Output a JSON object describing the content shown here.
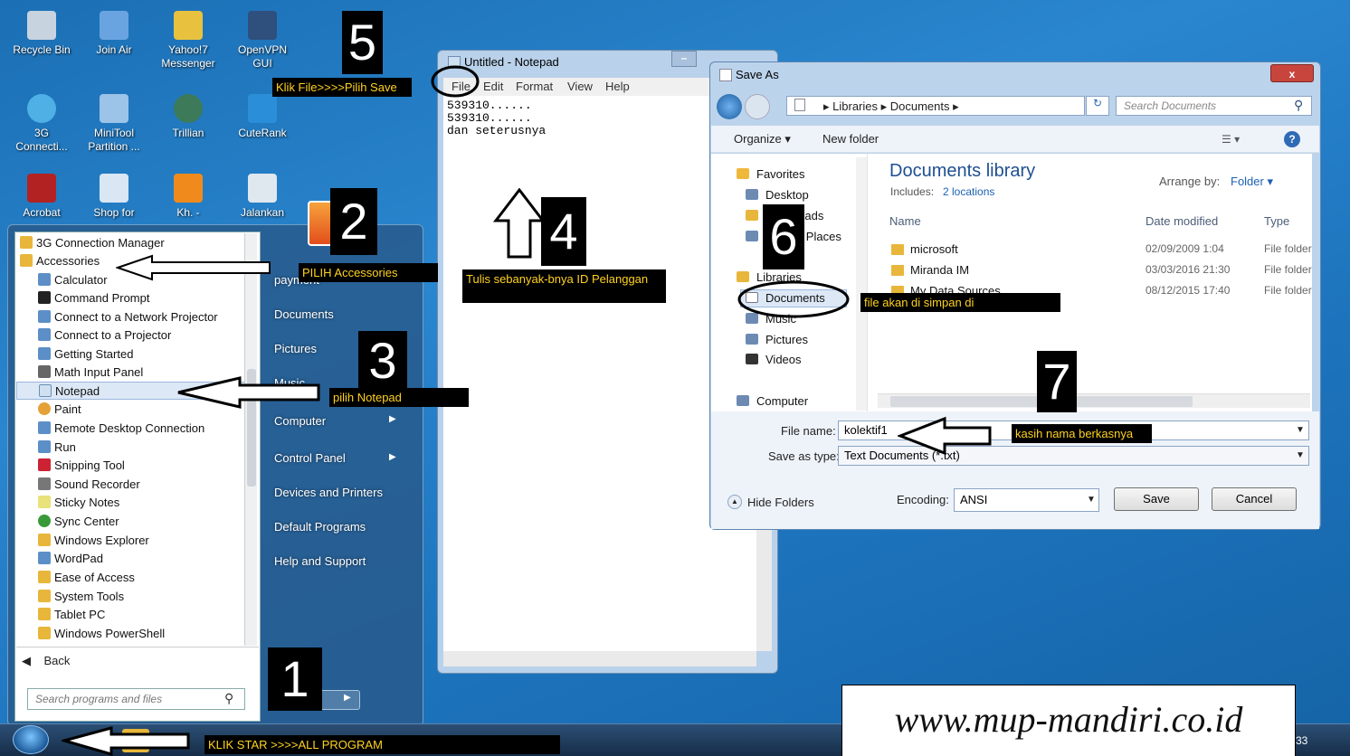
{
  "desktop": {
    "icons": [
      {
        "label": "Recycle Bin"
      },
      {
        "label": "Join Air"
      },
      {
        "label": "Yahoo!7 Messenger"
      },
      {
        "label": "OpenVPN GUI"
      },
      {
        "label": "3G Connecti..."
      },
      {
        "label": "MiniTool Partition ..."
      },
      {
        "label": "Trillian"
      },
      {
        "label": "CuteRank"
      },
      {
        "label": "Acrobat"
      },
      {
        "label": "Shop for"
      },
      {
        "label": "Kh. -"
      },
      {
        "label": "Jalankan"
      }
    ]
  },
  "start_menu": {
    "programs": [
      {
        "label": "3G Connection Manager",
        "kind": "folder"
      },
      {
        "label": "Accessories",
        "kind": "folder"
      },
      {
        "label": "Calculator",
        "kind": "app"
      },
      {
        "label": "Command Prompt",
        "kind": "app"
      },
      {
        "label": "Connect to a Network Projector",
        "kind": "app"
      },
      {
        "label": "Connect to a Projector",
        "kind": "app"
      },
      {
        "label": "Getting Started",
        "kind": "app"
      },
      {
        "label": "Math Input Panel",
        "kind": "app"
      },
      {
        "label": "Notepad",
        "kind": "app"
      },
      {
        "label": "Paint",
        "kind": "app"
      },
      {
        "label": "Remote Desktop Connection",
        "kind": "app"
      },
      {
        "label": "Run",
        "kind": "app"
      },
      {
        "label": "Snipping Tool",
        "kind": "app"
      },
      {
        "label": "Sound Recorder",
        "kind": "app"
      },
      {
        "label": "Sticky Notes",
        "kind": "app"
      },
      {
        "label": "Sync Center",
        "kind": "app"
      },
      {
        "label": "Windows Explorer",
        "kind": "app"
      },
      {
        "label": "WordPad",
        "kind": "app"
      },
      {
        "label": "Ease of Access",
        "kind": "folder"
      },
      {
        "label": "System Tools",
        "kind": "folder"
      },
      {
        "label": "Tablet PC",
        "kind": "folder"
      },
      {
        "label": "Windows PowerShell",
        "kind": "folder"
      }
    ],
    "back_label": "Back",
    "search_placeholder": "Search programs and files",
    "right_items": [
      "payment",
      "Documents",
      "Pictures",
      "Music",
      "Computer",
      "Control Panel",
      "Devices and Printers",
      "Default Programs",
      "Help and Support"
    ]
  },
  "notepad": {
    "title": "Untitled - Notepad",
    "menu": [
      "File",
      "Edit",
      "Format",
      "View",
      "Help"
    ],
    "content": "539310......\n539310......\ndan seterusnya"
  },
  "save_as": {
    "title": "Save As",
    "close": "x",
    "breadcrumb": "▸ Libraries ▸ Documents ▸",
    "search_placeholder": "Search Documents",
    "organize": "Organize ▾",
    "new_folder": "New folder",
    "nav": [
      "Favorites",
      "Desktop",
      "Downloads",
      "Recent Places",
      "Libraries",
      "Documents",
      "Music",
      "Pictures",
      "Videos",
      "Computer"
    ],
    "library_title": "Documents library",
    "includes_label": "Includes:",
    "includes_link": "2 locations",
    "arrange_label": "Arrange by:",
    "arrange_value": "Folder ▾",
    "columns": [
      "Name",
      "Date modified",
      "Type"
    ],
    "rows": [
      {
        "name": "microsoft",
        "date": "02/09/2009 1:04",
        "type": "File folder"
      },
      {
        "name": "Miranda IM",
        "date": "03/03/2016 21:30",
        "type": "File folder"
      },
      {
        "name": "My Data Sources",
        "date": "08/12/2015 17:40",
        "type": "File folder"
      }
    ],
    "file_name_label": "File name:",
    "file_name_value": "kolektif1",
    "save_type_label": "Save as type:",
    "save_type_value": "Text Documents (*.txt)",
    "hide_folders": "Hide Folders",
    "encoding_label": "Encoding:",
    "encoding_value": "ANSI",
    "save_button": "Save",
    "cancel_button": "Cancel"
  },
  "annotations": {
    "steps": [
      "1",
      "2",
      "3",
      "4",
      "5",
      "6",
      "7"
    ],
    "step1": "KLIK STAR >>>>ALL PROGRAM",
    "step2": "PILIH Accessories",
    "step3": "pilih Notepad",
    "step4": "Tulis sebanyak-bnya ID Pelanggan",
    "step5": "Klik File>>>>Pilih Save",
    "step6": "file akan di simpan di",
    "step7": "kasih nama berkasnya"
  },
  "watermark": "www.mup-mandiri.co.id",
  "taskbar": {
    "clock": "33"
  }
}
